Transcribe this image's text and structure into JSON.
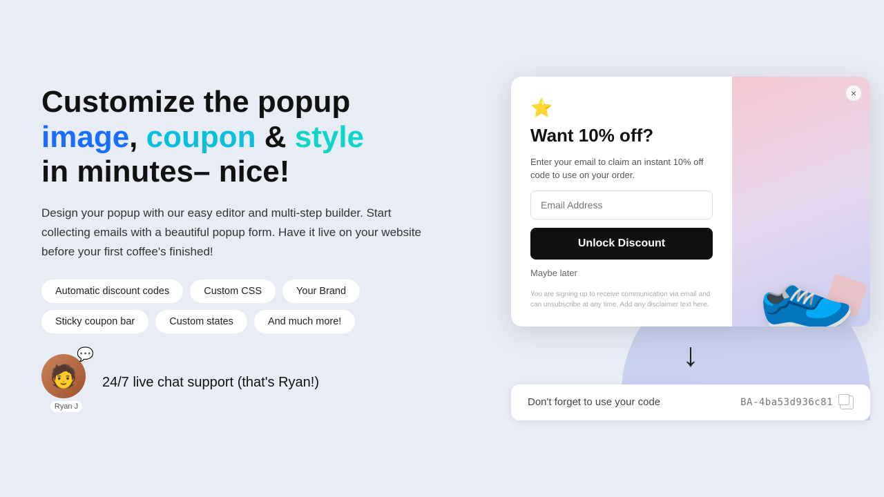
{
  "left": {
    "headline_part1": "Customize the popup",
    "headline_highlight1": "image",
    "headline_sep1": ",",
    "headline_highlight2": "coupon",
    "headline_mid": "& ",
    "headline_highlight3": "style",
    "headline_part2": "in minutes– nice!",
    "subtext": "Design your popup with our easy editor and multi-step builder. Start collecting emails with a beautiful popup form. Have it live on your website before your first coffee's finished!",
    "tags": [
      "Automatic discount codes",
      "Custom CSS",
      "Your Brand",
      "Sticky coupon bar",
      "Custom states",
      "And much more!"
    ],
    "support_text": "24/7 live chat support ",
    "support_parens": "(that's Ryan!)",
    "avatar_name": "Ryan J",
    "avatar_emoji": "🧑"
  },
  "popup": {
    "close_label": "×",
    "star_icon": "✦",
    "title": "Want 10% off?",
    "description": "Enter your email to claim an instant 10% off code to use on your order.",
    "email_placeholder": "Email Address",
    "button_label": "Unlock Discount",
    "maybe_later": "Maybe later",
    "disclaimer": "You are signing up to receive communication via email and can unsubscribe at any time. Add any disclaimer text here."
  },
  "coupon_bar": {
    "label": "Don't forget to use your code",
    "code": "BA-4ba53d936c81",
    "copy_icon": "copy-icon"
  },
  "arrow": "↓"
}
